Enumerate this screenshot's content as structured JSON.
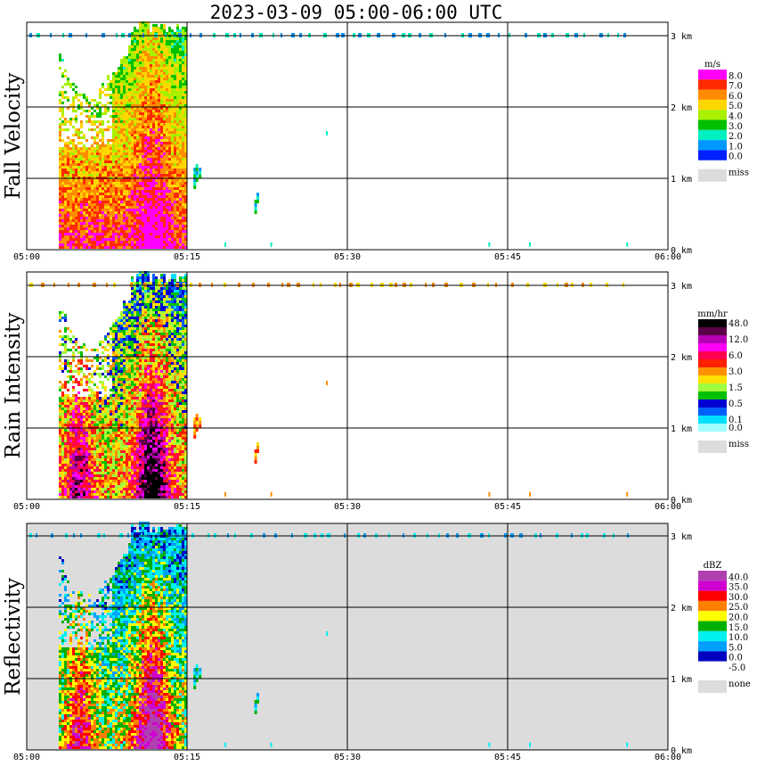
{
  "title": "2023-03-09  05:00-06:00 UTC",
  "time_ticks": [
    "05:00",
    "05:15",
    "05:30",
    "05:45",
    "06:00"
  ],
  "height_ticks": [
    "0 km",
    "1 km",
    "2 km",
    "3 km"
  ],
  "panels": [
    {
      "ylabel": "Fall Velocity",
      "unit": "m/s",
      "legend": [
        {
          "label": "8.0",
          "color": "#ff00ff"
        },
        {
          "label": "7.0",
          "color": "#ff2a00"
        },
        {
          "label": "6.0",
          "color": "#ff8c00"
        },
        {
          "label": "5.0",
          "color": "#ffd700"
        },
        {
          "label": "4.0",
          "color": "#a8f000"
        },
        {
          "label": "3.0",
          "color": "#00c000"
        },
        {
          "label": "2.0",
          "color": "#00f0c0"
        },
        {
          "label": "1.0",
          "color": "#0098ff"
        },
        {
          "label": "0.0",
          "color": "#0020ff"
        }
      ],
      "miss_label": "miss",
      "miss_color": "#dcdcdc",
      "background": "#ffffff"
    },
    {
      "ylabel": "Rain Intensity",
      "unit": "mm/hr",
      "legend": [
        {
          "label": "48.0",
          "color": "#000000"
        },
        {
          "label": "",
          "color": "#5a0046"
        },
        {
          "label": "12.0",
          "color": "#b400b4"
        },
        {
          "label": "",
          "color": "#ff00ff"
        },
        {
          "label": "6.0",
          "color": "#ff0050"
        },
        {
          "label": "",
          "color": "#ff2000"
        },
        {
          "label": "3.0",
          "color": "#ff9000"
        },
        {
          "label": "",
          "color": "#ffe000"
        },
        {
          "label": "1.5",
          "color": "#a0ff40"
        },
        {
          "label": "",
          "color": "#00c000"
        },
        {
          "label": "0.5",
          "color": "#0000d0"
        },
        {
          "label": "",
          "color": "#0060ff"
        },
        {
          "label": "0.1",
          "color": "#00e0ff"
        },
        {
          "label": "0.0",
          "color": "#a0ffff"
        }
      ],
      "miss_label": "miss",
      "miss_color": "#dcdcdc",
      "background": "#ffffff"
    },
    {
      "ylabel": "Reflectivity",
      "unit": "dBZ",
      "legend": [
        {
          "label": "40.0",
          "color": "#b040b0"
        },
        {
          "label": "35.0",
          "color": "#d000d0"
        },
        {
          "label": "30.0",
          "color": "#ff0000"
        },
        {
          "label": "25.0",
          "color": "#ff8000"
        },
        {
          "label": "20.0",
          "color": "#ffff00"
        },
        {
          "label": "15.0",
          "color": "#00b000"
        },
        {
          "label": "10.0",
          "color": "#00f0f0"
        },
        {
          "label": "5.0",
          "color": "#00a0ff"
        },
        {
          "label": "0.0",
          "color": "#0000c0"
        },
        {
          "label": "-5.0",
          "color": "#ffffff"
        }
      ],
      "miss_label": "none",
      "miss_color": "#dcdcdc",
      "background": "#dcdcdc"
    }
  ],
  "chart_data": [
    {
      "type": "heatmap",
      "variable": "Fall Velocity",
      "unit": "m/s",
      "x_range": [
        "05:00",
        "06:00"
      ],
      "y_range_km": [
        0,
        3.1
      ],
      "echo_core": {
        "x_start": "05:03",
        "x_end": "05:15",
        "top_km": 3.1
      },
      "scattered_echo": [
        {
          "time": "05:21",
          "height_km": 0.7
        },
        {
          "time": "05:28",
          "height_km": 1.6
        },
        {
          "time": "05:43",
          "height_km": 0.05
        },
        {
          "time": "05:47",
          "height_km": 0.05
        },
        {
          "time": "05:56",
          "height_km": 0.05
        }
      ]
    },
    {
      "type": "heatmap",
      "variable": "Rain Intensity",
      "unit": "mm/hr",
      "x_range": [
        "05:00",
        "06:00"
      ],
      "y_range_km": [
        0,
        3.1
      ],
      "echo_core": {
        "x_start": "05:03",
        "x_end": "05:15",
        "top_km": 3.1
      }
    },
    {
      "type": "heatmap",
      "variable": "Reflectivity",
      "unit": "dBZ",
      "x_range": [
        "05:00",
        "06:00"
      ],
      "y_range_km": [
        0,
        3.1
      ],
      "echo_core": {
        "x_start": "05:03",
        "x_end": "05:15",
        "top_km": 3.1
      }
    }
  ]
}
